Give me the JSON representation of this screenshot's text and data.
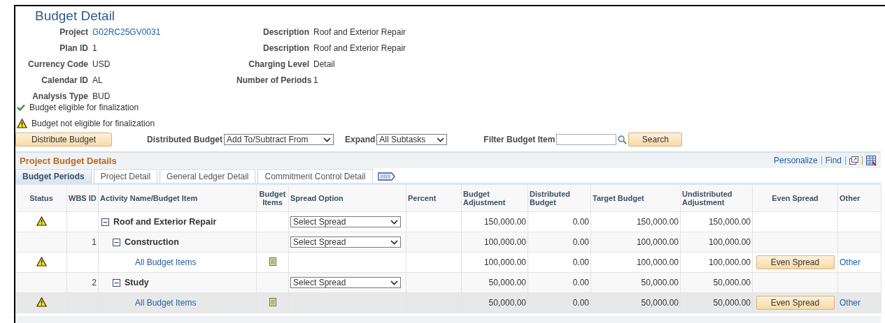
{
  "page_title": "Budget Detail",
  "fields_left": [
    {
      "label": "Project",
      "value": "G02RC25GV0031",
      "link": true
    },
    {
      "label": "Plan ID",
      "value": "1",
      "link": false
    },
    {
      "label": "Currency Code",
      "value": "USD",
      "link": false
    },
    {
      "label": "Calendar ID",
      "value": "AL",
      "link": false
    },
    {
      "label": "Analysis Type",
      "value": "BUD",
      "link": false
    }
  ],
  "fields_right": [
    {
      "label": "Description",
      "value": "Roof and Exterior Repair"
    },
    {
      "label": "Description",
      "value": "Roof and Exterior Repair"
    },
    {
      "label": "Charging Level",
      "value": "Detail"
    },
    {
      "label": "Number of Periods",
      "value": "1"
    }
  ],
  "messages": [
    {
      "kind": "ok",
      "text": "Budget eligible for finalization"
    },
    {
      "kind": "warning",
      "text": "Budget not eligible for finalization"
    }
  ],
  "toolbar": {
    "distribute_button": "Distribute Budget",
    "distributed_label": "Distributed Budget",
    "distributed_value": "Add To/Subtract From",
    "expand_label": "Expand",
    "expand_value": "All Subtasks",
    "filter_label": "Filter Budget Item",
    "search_button": "Search"
  },
  "grid": {
    "title": "Project Budget Details",
    "links": [
      "Personalize",
      "Find"
    ],
    "tabs": [
      {
        "label": "Budget Periods",
        "selected": true
      },
      {
        "label": "Project Detail",
        "selected": false
      },
      {
        "label": "General Ledger Detail",
        "selected": false
      },
      {
        "label": "Commitment Control Detail",
        "selected": false
      }
    ],
    "columns": [
      "Status",
      "WBS ID",
      "Activity Name/Budget Item",
      "Budget Items",
      "Spread Option",
      "Percent",
      "Budget Adjustment",
      "Distributed Budget",
      "Target Budget",
      "Undistributed Adjustment",
      "Even Spread",
      "Other"
    ],
    "rows": [
      {
        "kind": "task",
        "wbs_id": "",
        "name": "Roof and Exterior Repair",
        "warning": true,
        "expanded": true,
        "spread_option": "Select Spread",
        "budget_adjustment": "150,000.00",
        "distributed_budget": "0.00",
        "target_budget": "150,000.00",
        "undistributed_adjustment": "150,000.00",
        "selected": false,
        "children": [
          {
            "kind": "task",
            "wbs_id": "1",
            "name": "Construction",
            "warning": false,
            "expanded": true,
            "spread_option": "Select Spread",
            "budget_adjustment": "100,000.00",
            "distributed_budget": "0.00",
            "target_budget": "100,000.00",
            "undistributed_adjustment": "100,000.00",
            "selected": false,
            "children": [
              {
                "kind": "item",
                "name": "All Budget Items",
                "warning": true,
                "budget_adjustment": "100,000.00",
                "distributed_budget": "0.00",
                "target_budget": "100,000.00",
                "undistributed_adjustment": "100,000.00",
                "even_spread": "Even Spread",
                "other": "Other",
                "selected": false
              }
            ]
          },
          {
            "kind": "task",
            "wbs_id": "2",
            "name": "Study",
            "warning": false,
            "expanded": true,
            "spread_option": "Select Spread",
            "budget_adjustment": "50,000.00",
            "distributed_budget": "0.00",
            "target_budget": "50,000.00",
            "undistributed_adjustment": "50,000.00",
            "selected": false,
            "children": [
              {
                "kind": "item",
                "name": "All Budget Items",
                "warning": true,
                "budget_adjustment": "50,000.00",
                "distributed_budget": "0.00",
                "target_budget": "50,000.00",
                "undistributed_adjustment": "50,000.00",
                "even_spread": "Even Spread",
                "other": "Other",
                "selected": true
              }
            ]
          }
        ]
      }
    ]
  }
}
